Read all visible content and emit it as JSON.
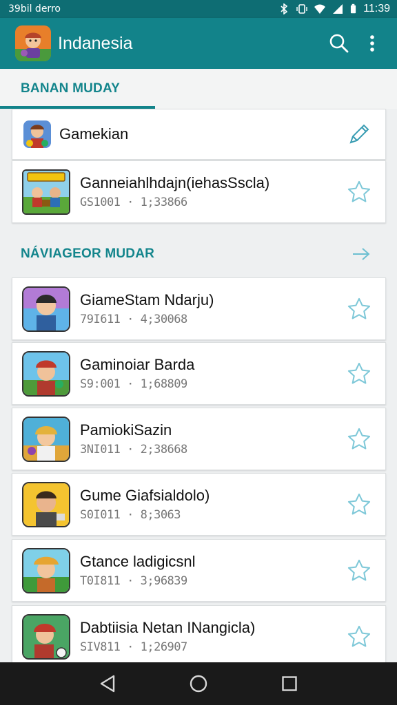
{
  "status_bar": {
    "left_text": "39bil derro",
    "time": "11:39",
    "icons": [
      "bluetooth-icon",
      "vibrate-icon",
      "wifi-icon",
      "signal-icon",
      "battery-icon"
    ]
  },
  "app_bar": {
    "title": "Indanesia",
    "actions": [
      "search-icon",
      "more-vert-icon"
    ]
  },
  "section1": {
    "title": "BANAN MUDAY"
  },
  "top_items": [
    {
      "title": "Gamekian",
      "action_icon": "edit-icon"
    },
    {
      "title": "Ganneiahlhdajn(iehasSscla)",
      "subtitle": "GS1001 · 1;33866",
      "action_icon": "star-icon"
    }
  ],
  "section2": {
    "title": "NÁVIAGEOR MUDAR",
    "action_icon": "arrow-right-icon"
  },
  "list_items": [
    {
      "title": "GiameStam Ndarju)",
      "subtitle": "79I611 · 4;30068",
      "action_icon": "star-icon"
    },
    {
      "title": "Gaminoiar Barda",
      "subtitle": "S9:001 · 1;68809",
      "action_icon": "star-icon"
    },
    {
      "title": "PamiokiSazin",
      "subtitle": "3NI011 · 2;38668",
      "action_icon": "star-icon"
    },
    {
      "title": "Gume Giafsialdolo)",
      "subtitle": "S0I011 · 8;3063",
      "action_icon": "star-icon"
    },
    {
      "title": "Gtance ladigicsnl",
      "subtitle": "T0I811 · 3;96839",
      "action_icon": "star-icon"
    },
    {
      "title": "Dabtiisia Netan INangicla)",
      "subtitle": "SIV811 · 1;26907",
      "action_icon": "star-icon"
    }
  ],
  "nav_bar": {
    "buttons": [
      "back-icon",
      "home-icon",
      "recents-icon"
    ]
  },
  "colors": {
    "app_bar": "#12838a",
    "status_bar": "#0e6d73",
    "accent": "#13858c",
    "star": "#7ec8d8"
  }
}
